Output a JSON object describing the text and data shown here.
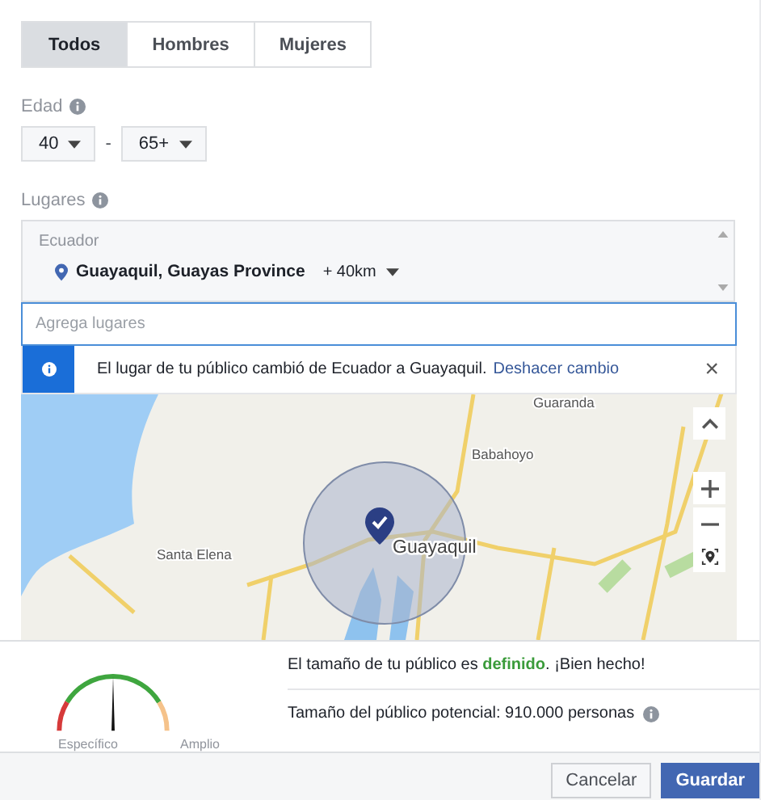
{
  "gender_tabs": [
    {
      "label": "Todos",
      "selected": true
    },
    {
      "label": "Hombres",
      "selected": false
    },
    {
      "label": "Mujeres",
      "selected": false
    }
  ],
  "age": {
    "label": "Edad",
    "min": "40",
    "separator": "-",
    "max": "65+"
  },
  "locations": {
    "label": "Lugares",
    "country": "Ecuador",
    "items": [
      {
        "name": "Guayaquil, Guayas Province",
        "radius": "+ 40km"
      }
    ],
    "input": {
      "placeholder": "Agrega lugares"
    }
  },
  "notice": {
    "text": "El lugar de tu público cambió de Ecuador a Guayaquil.",
    "link": "Deshacer cambio",
    "close": "×"
  },
  "map": {
    "labels": [
      {
        "text": "Guaranda",
        "kind": "town"
      },
      {
        "text": "Babahoyo",
        "kind": "town"
      },
      {
        "text": "Santa Elena",
        "kind": "town"
      },
      {
        "text": "Guayaquil",
        "kind": "city"
      }
    ],
    "controls": [
      {
        "kind": "up"
      },
      {
        "kind": "zoom_in"
      },
      {
        "kind": "zoom_out"
      },
      {
        "kind": "locate"
      }
    ]
  },
  "audience": {
    "gauge": {
      "level": 0.5,
      "left_label": "Específico",
      "right_label": "Amplio"
    },
    "message": "El tamaño de tu público es **definido**. ¡Bien hecho!",
    "potential": "Tamaño del público potencial: 910.000 personas"
  },
  "buttons": [
    {
      "label": "Cancelar",
      "kind": "secondary"
    },
    {
      "label": "Guardar",
      "kind": "primary"
    }
  ]
}
